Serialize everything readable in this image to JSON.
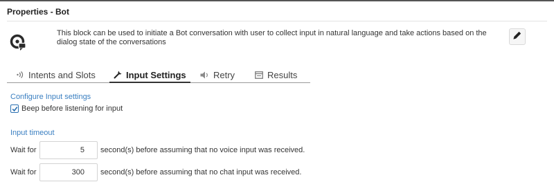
{
  "panel": {
    "title": "Properties - Bot"
  },
  "block": {
    "icon": "bot-chat-icon",
    "description": "This block can be used to initiate a Bot conversation with user to collect input in natural language and take actions based on the dialog state of the conversations",
    "edit_icon": "pencil-icon"
  },
  "tabs": [
    {
      "label": "Intents and Slots",
      "icon": "signal-icon",
      "active": false
    },
    {
      "label": "Input Settings",
      "icon": "wrench-icon",
      "active": true
    },
    {
      "label": "Retry",
      "icon": "speaker-icon",
      "active": false
    },
    {
      "label": "Results",
      "icon": "form-icon",
      "active": false
    }
  ],
  "input_settings": {
    "section_label": "Configure Input settings",
    "beep_label": "Beep before listening for input",
    "beep_checked": true
  },
  "input_timeout": {
    "section_label": "Input timeout",
    "rows": [
      {
        "prefix": "Wait for",
        "value": "5",
        "suffix": "second(s) before assuming that no voice input was received."
      },
      {
        "prefix": "Wait for",
        "value": "300",
        "suffix": "second(s) before assuming that no chat input was received."
      }
    ]
  },
  "colors": {
    "accent": "#3a7fc1",
    "text": "#333333",
    "border": "#555555"
  }
}
